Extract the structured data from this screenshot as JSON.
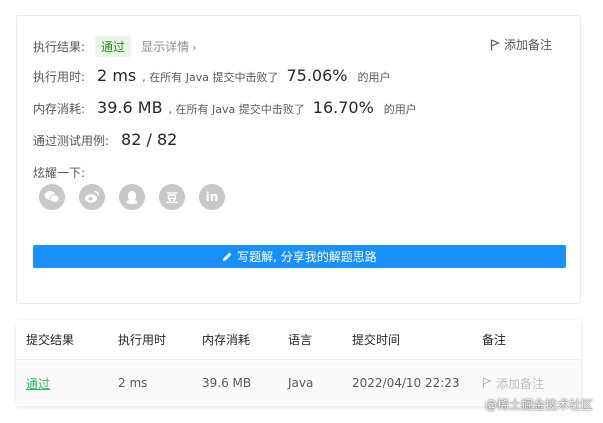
{
  "result": {
    "label": "执行结果:",
    "status": "通过",
    "detail_link": "显示详情",
    "note_button": "添加备注"
  },
  "runtime": {
    "label": "执行用时:",
    "value": "2 ms",
    "middle": ", 在所有 Java 提交中击败了",
    "percent": "75.06%",
    "suffix": "的用户"
  },
  "memory": {
    "label": "内存消耗:",
    "value": "39.6 MB",
    "middle": ", 在所有 Java 提交中击败了",
    "percent": "16.70%",
    "suffix": "的用户"
  },
  "testcases": {
    "label": "通过测试用例:",
    "value": "82 / 82"
  },
  "share": {
    "label": "炫耀一下:",
    "icons": [
      "wechat-icon",
      "weibo-icon",
      "qq-icon",
      "douban-icon",
      "linkedin-icon"
    ],
    "douban_glyph": "豆",
    "linkedin_glyph": "in"
  },
  "write_solution_button": "写题解, 分享我的解题思路",
  "table": {
    "headers": [
      "提交结果",
      "执行用时",
      "内存消耗",
      "语言",
      "提交时间",
      "备注"
    ],
    "row": {
      "result": "通过",
      "runtime": "2 ms",
      "memory": "39.6 MB",
      "language": "Java",
      "time": "2022/04/10 22:23",
      "note": "添加备注"
    }
  },
  "watermark": "@稀土掘金技术社区",
  "colors": {
    "accent": "#1a90ff",
    "success": "#2db55d",
    "badge_bg": "#e9f7e7"
  }
}
